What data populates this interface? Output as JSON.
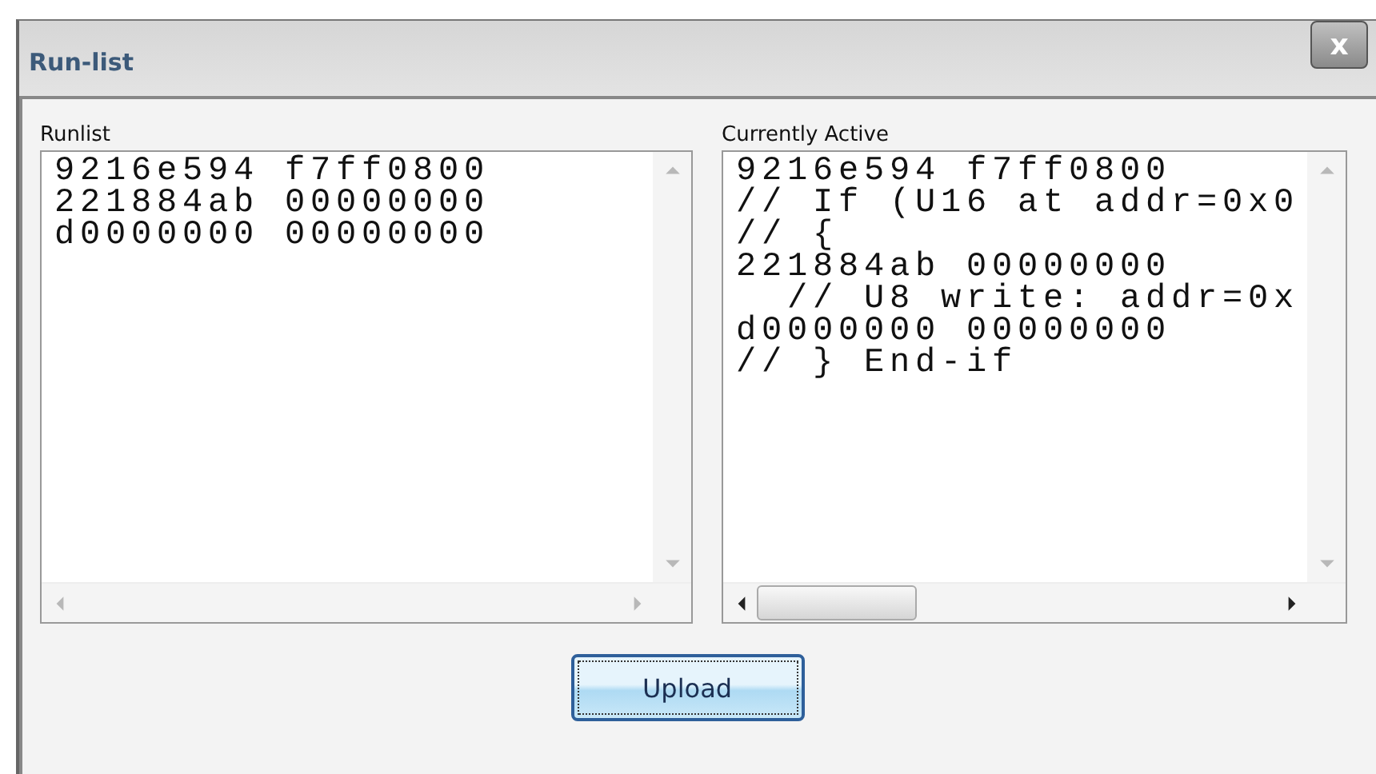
{
  "window": {
    "title": "Run-list",
    "close_icon": "x"
  },
  "lists": [
    {
      "label": "Runlist",
      "scrollbar_enabled": false,
      "lines": [
        "9216e594 f7ff0800",
        "221884ab 00000000",
        "d0000000 00000000"
      ]
    },
    {
      "label": "Currently Active",
      "scrollbar_enabled": true,
      "lines": [
        "9216e594 f7ff0800",
        "// If (U16 at addr=0x0",
        "// {",
        "221884ab 00000000",
        "  // U8 write: addr=0x",
        "d0000000 00000000",
        "// } End-if"
      ]
    }
  ],
  "buttons": [
    "Upload"
  ]
}
